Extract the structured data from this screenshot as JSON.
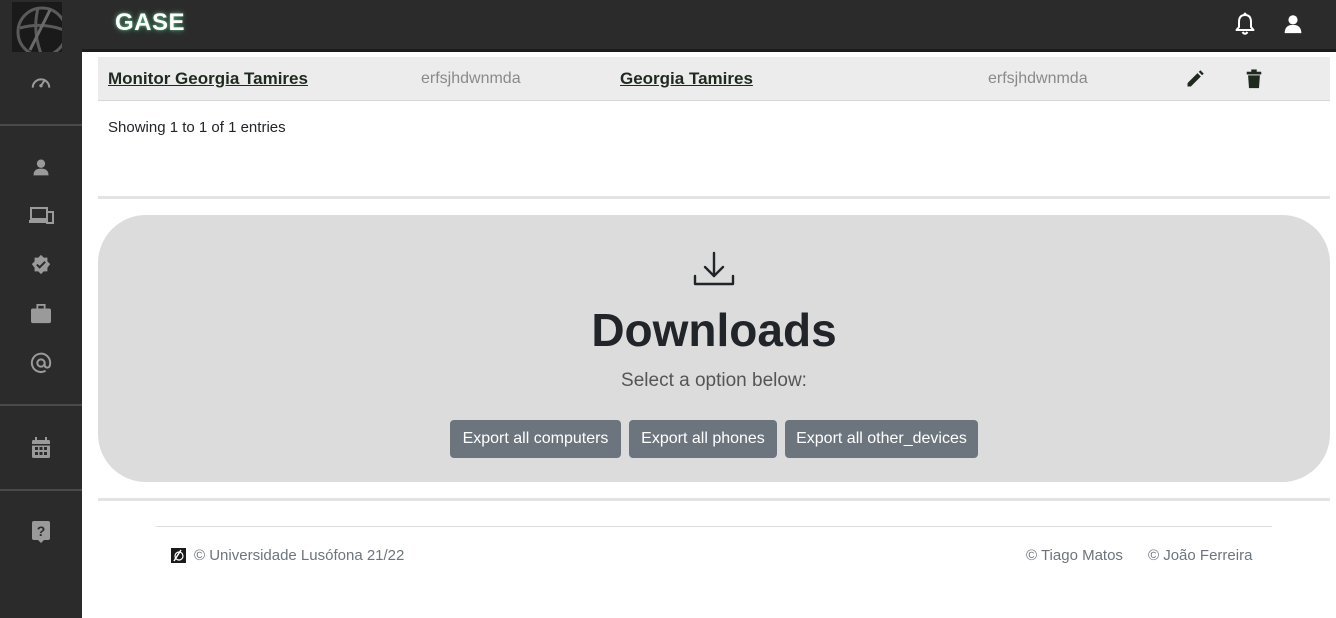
{
  "app": {
    "brand": "GASE"
  },
  "sidebar": {
    "items": [
      {
        "icon": "dashboard-icon"
      },
      {
        "icon": "user-icon"
      },
      {
        "icon": "devices-icon"
      },
      {
        "icon": "verified-badge-icon"
      },
      {
        "icon": "briefcase-icon"
      },
      {
        "icon": "at-sign-icon"
      },
      {
        "icon": "calendar-icon"
      },
      {
        "icon": "help-icon"
      }
    ]
  },
  "navbar": {
    "icons": [
      "bell-icon",
      "user-icon"
    ]
  },
  "table": {
    "row": {
      "col1": "Monitor Georgia Tamires",
      "col2": "erfsjhdwnmda",
      "col3": "Georgia Tamires",
      "col4": "erfsjhdwnmda"
    },
    "info": "Showing 1 to 1 of 1 entries"
  },
  "downloads": {
    "title": "Downloads",
    "subtitle": "Select a option below:",
    "buttons": [
      "Export all computers",
      "Export all phones",
      "Export all other_devices"
    ]
  },
  "footer": {
    "left": "© Universidade Lusófona 21/22",
    "author1": "© Tiago Matos",
    "author2": "© João Ferreira"
  },
  "colors": {
    "sidebar_bg": "#2b2b2b",
    "row_bg": "#ececec",
    "downloads_bg": "#dcdcdc",
    "button_bg": "#6c757d"
  }
}
